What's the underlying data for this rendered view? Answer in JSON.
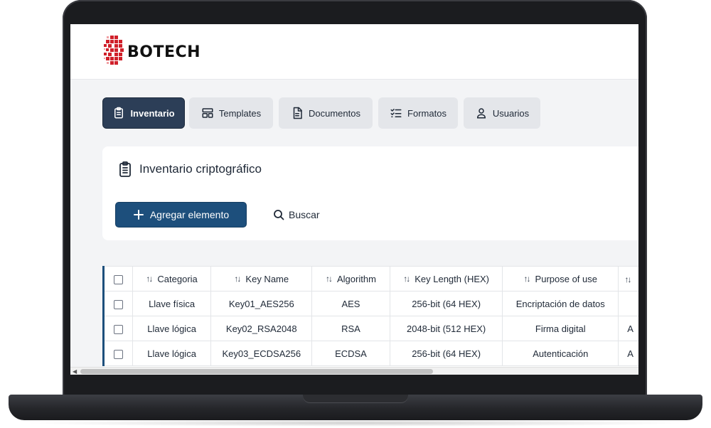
{
  "brand": {
    "name": "BOTECH",
    "accent": "#d0202a"
  },
  "tabs": [
    {
      "label": "Inventario",
      "icon": "clipboard-list-icon",
      "active": true
    },
    {
      "label": "Templates",
      "icon": "layout-template-icon",
      "active": false
    },
    {
      "label": "Documentos",
      "icon": "document-icon",
      "active": false
    },
    {
      "label": "Formatos",
      "icon": "list-checks-icon",
      "active": false
    },
    {
      "label": "Usuarios",
      "icon": "user-icon",
      "active": false
    }
  ],
  "section": {
    "title": "Inventario criptográfico",
    "add_label": "Agregar elemento",
    "search_label": "Buscar"
  },
  "table": {
    "headers": [
      "Categoria",
      "Key Name",
      "Algorithm",
      "Key Length (HEX)",
      "Purpose of use",
      ""
    ],
    "rows": [
      [
        "Llave física",
        "Key01_AES256",
        "AES",
        "256-bit (64 HEX)",
        "Encriptación de datos",
        ""
      ],
      [
        "Llave lógica",
        "Key02_RSA2048",
        "RSA",
        "2048-bit (512 HEX)",
        "Firma digital",
        "A"
      ],
      [
        "Llave lógica",
        "Key03_ECDSA256",
        "ECDSA",
        "256-bit (64 HEX)",
        "Autenticación",
        "A"
      ]
    ]
  },
  "colors": {
    "primary": "#1d4f7c",
    "active_tab": "#2c3e57",
    "tab_bg": "#e4e6ea"
  }
}
